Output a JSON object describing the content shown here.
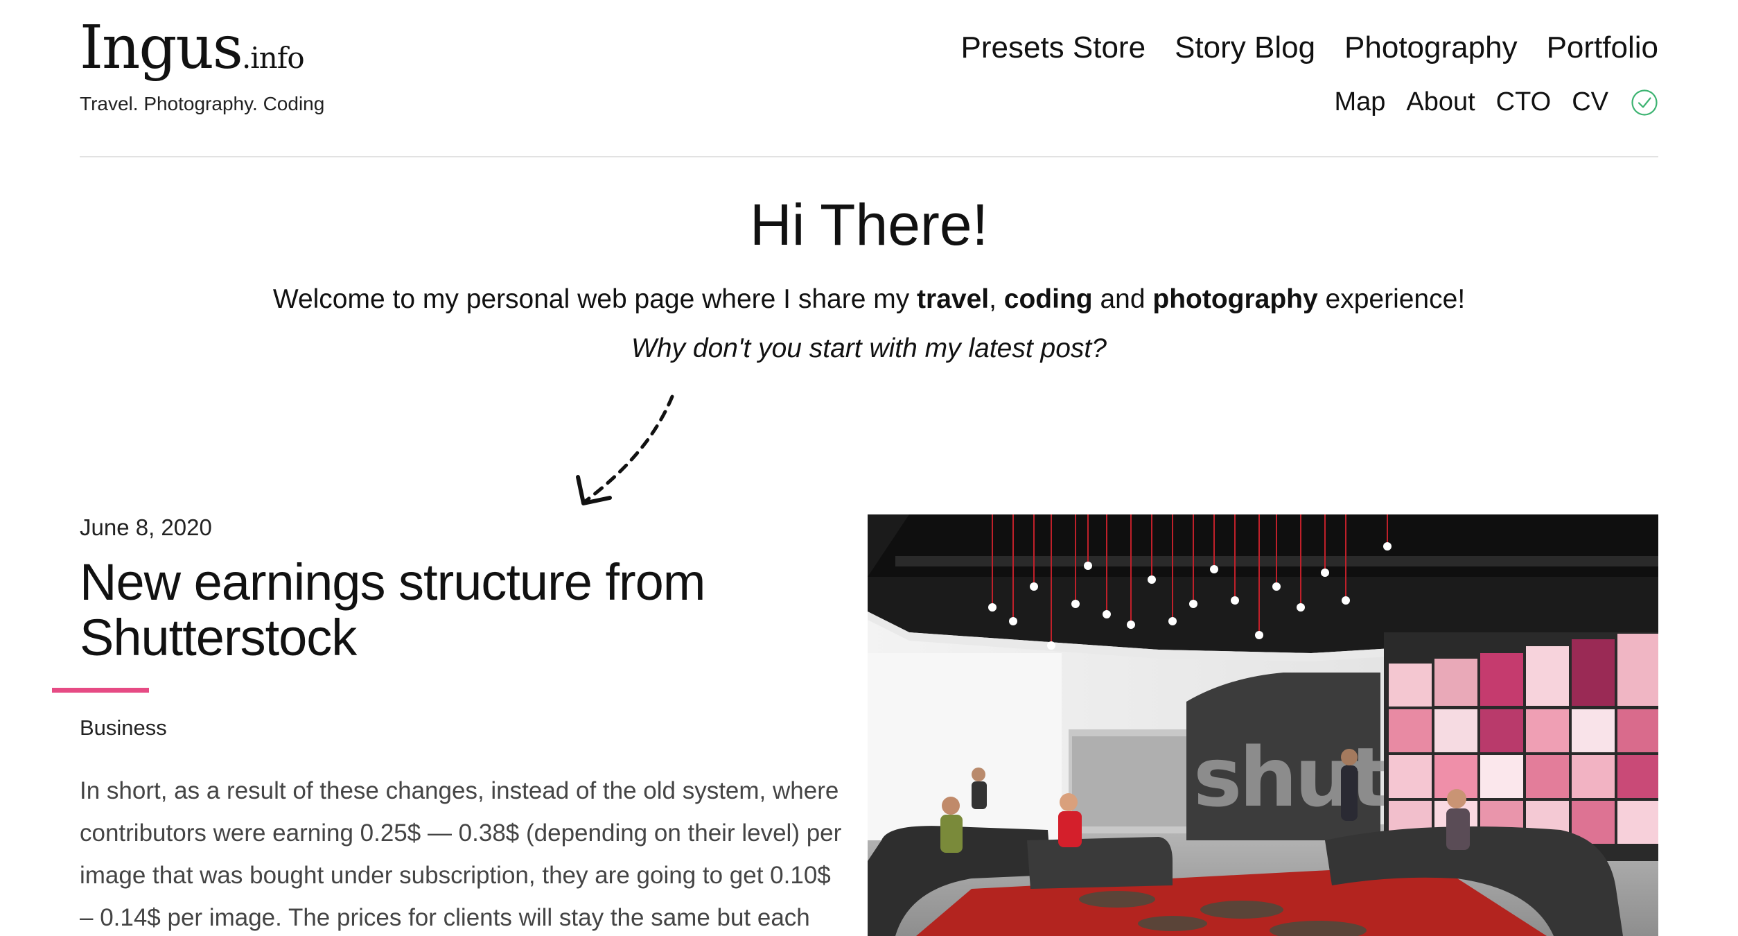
{
  "site": {
    "logo_main": "Ingus",
    "logo_suffix": ".info",
    "tagline": "Travel. Photography. Coding"
  },
  "nav": {
    "primary": [
      "Presets Store",
      "Story Blog",
      "Photography",
      "Portfolio"
    ],
    "secondary": [
      "Map",
      "About",
      "CTO",
      "CV"
    ],
    "check_icon": "check-circle-icon",
    "check_color": "#3cb371"
  },
  "hero": {
    "title": "Hi There!",
    "text_before": "Welcome to my personal web page where I share my ",
    "bold1": "travel",
    "sep1": ", ",
    "bold2": "coding",
    "sep2": " and ",
    "bold3": "photography",
    "text_after": " experience!",
    "cta": "Why don't you start with my latest post?"
  },
  "post": {
    "date": "June 8, 2020",
    "title": "New earnings structure from Shutterstock",
    "category": "Business",
    "excerpt": "In short, as a result of these changes, instead of the old system, where contributors were earning 0.25$ — 0.38$ (depending on their level) per image that was bought under subscription, they are going to get 0.10$ – 0.14$ per image. The prices for clients will stay the same but each",
    "accent_color": "#e64b84",
    "image_wall_text": "shutterstock"
  }
}
